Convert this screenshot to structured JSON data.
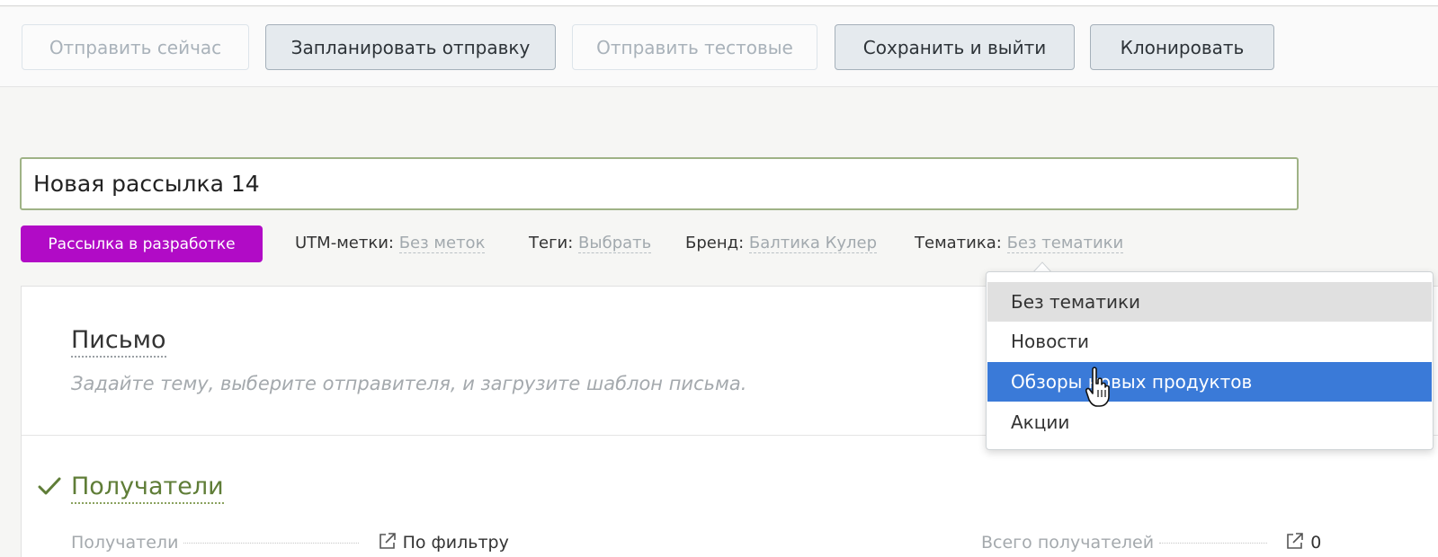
{
  "toolbar": {
    "send_now": "Отправить сейчас",
    "schedule": "Запланировать отправку",
    "send_test": "Отправить тестовые",
    "save_exit": "Сохранить и выйти",
    "clone": "Клонировать"
  },
  "campaign": {
    "name": "Новая рассылка 14",
    "status": "Рассылка в разработке"
  },
  "meta": {
    "utm_label": "UTM-метки:",
    "utm_value": "Без меток",
    "tags_label": "Теги:",
    "tags_value": "Выбрать",
    "brand_label": "Бренд:",
    "brand_value": "Балтика Кулер",
    "theme_label": "Тематика:",
    "theme_value": "Без тематики"
  },
  "letter": {
    "title": "Письмо",
    "description": "Задайте тему, выберите отправителя, и загрузите шаблон письма."
  },
  "recipients": {
    "title": "Получатели",
    "field_label": "Получатели",
    "field_value": "По фильтру",
    "total_label": "Всего получателей",
    "total_value": "0"
  },
  "theme_dropdown": {
    "options": [
      "Без тематики",
      "Новости",
      "Обзоры новых продуктов",
      "Акции"
    ],
    "selected_index": 0,
    "hovered_index": 2
  },
  "colors": {
    "status_badge": "#b10bc6",
    "hover_item": "#3a7ad8",
    "check": "#5f7d37"
  },
  "icons": {
    "check": "check-icon",
    "external_link": "external-link-icon",
    "cursor": "hand-pointer-icon"
  }
}
